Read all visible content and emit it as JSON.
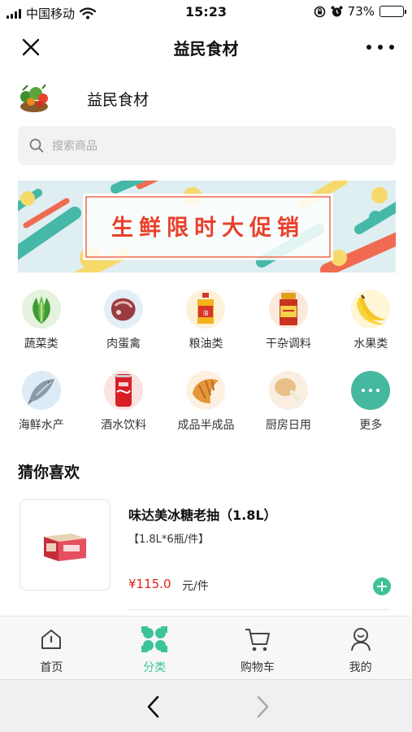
{
  "status_bar": {
    "carrier": "中国移动",
    "time": "15:23",
    "battery": "73%",
    "battery_level": 0.73
  },
  "navbar": {
    "title": "益民食材",
    "close_icon": "close-icon",
    "more_icon": "more-dots-icon"
  },
  "shop": {
    "name": "益民食材",
    "logo_icon": "vegetables-basket-logo"
  },
  "search": {
    "placeholder": "搜索商品",
    "icon": "search-icon"
  },
  "banner": {
    "text": "生鲜限时大促销",
    "accent_colors": [
      "#45b8a8",
      "#f06a52",
      "#f7d96b",
      "#dfeef0"
    ]
  },
  "categories": [
    {
      "label": "蔬菜类",
      "icon": "vegetable-icon"
    },
    {
      "label": "肉蛋禽",
      "icon": "meat-icon"
    },
    {
      "label": "粮油类",
      "icon": "cooking-oil-icon"
    },
    {
      "label": "干杂调料",
      "icon": "sauce-jar-icon"
    },
    {
      "label": "水果类",
      "icon": "banana-icon"
    },
    {
      "label": "海鲜水产",
      "icon": "fish-icon"
    },
    {
      "label": "酒水饮料",
      "icon": "cola-can-icon"
    },
    {
      "label": "成品半成品",
      "icon": "croissant-icon"
    },
    {
      "label": "厨房日用",
      "icon": "chicken-leg-icon"
    },
    {
      "label": "更多",
      "icon": "more-dots-icon"
    }
  ],
  "recommend": {
    "title": "猜你喜欢",
    "products": [
      {
        "name": "味达美冰糖老抽（1.8L）",
        "spec": "【1.8L*6瓶/件】",
        "price": "¥115.0",
        "unit": "元/件"
      }
    ]
  },
  "tabbar": {
    "tabs": [
      {
        "label": "首页",
        "icon": "home-icon",
        "active": false
      },
      {
        "label": "分类",
        "icon": "category-clover-icon",
        "active": true
      },
      {
        "label": "购物车",
        "icon": "cart-icon",
        "active": false
      },
      {
        "label": "我的",
        "icon": "profile-icon",
        "active": false
      }
    ],
    "active_color": "#3cc39a"
  },
  "browser": {
    "back_icon": "chevron-left-icon",
    "forward_icon": "chevron-right-icon"
  }
}
